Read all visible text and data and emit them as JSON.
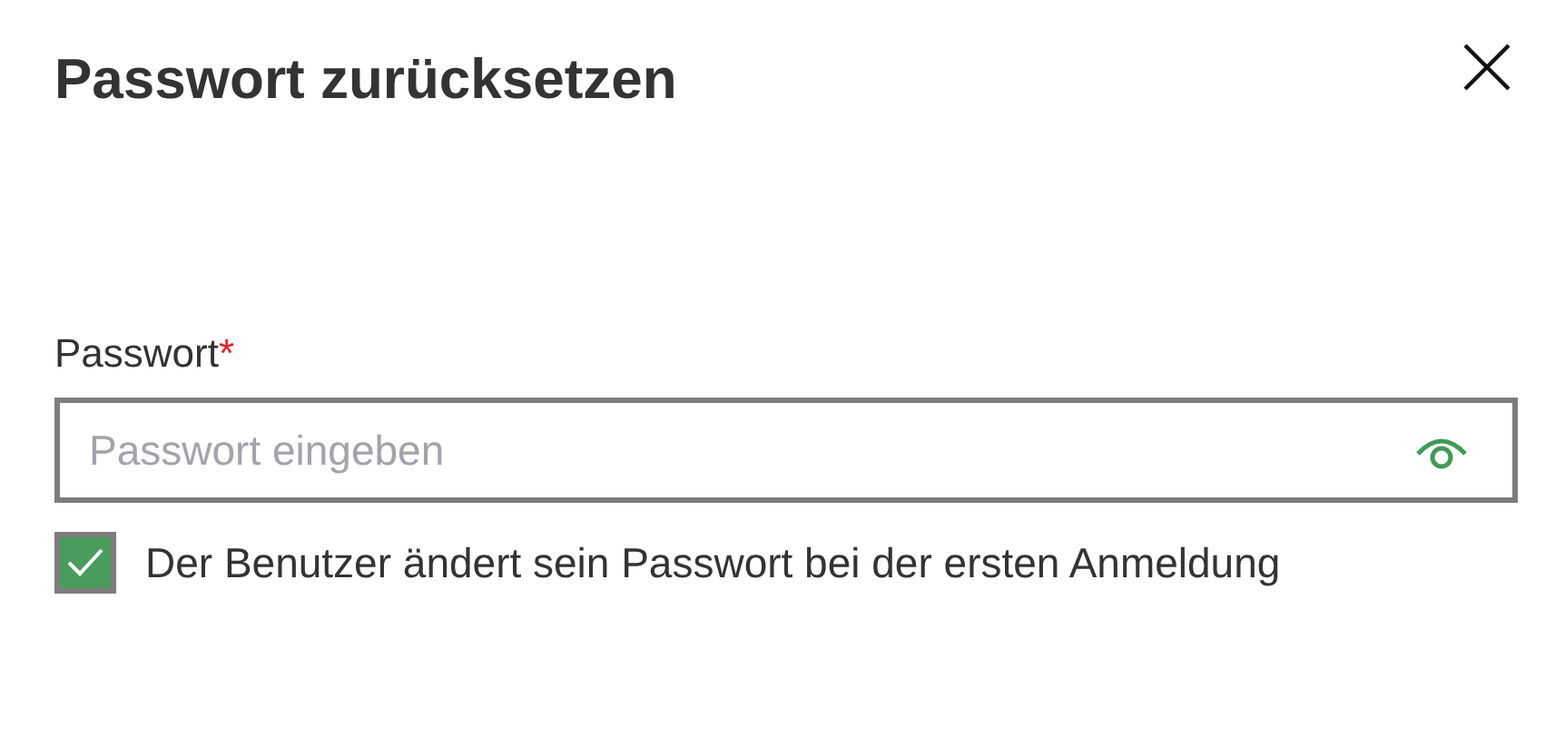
{
  "dialog": {
    "title": "Passwort zurücksetzen"
  },
  "password": {
    "label": "Passwort",
    "required_mark": "*",
    "placeholder": "Passwort eingeben"
  },
  "must_change": {
    "label": "Der Benutzer ändert sein Passwort bei der ersten Anmeldung",
    "checked": true
  }
}
